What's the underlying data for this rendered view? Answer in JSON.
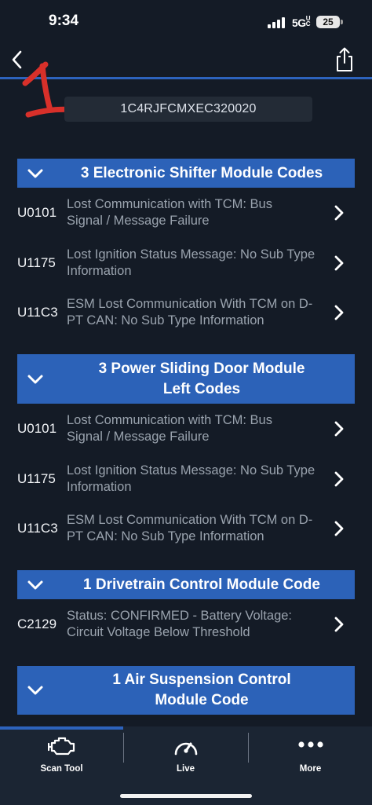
{
  "status_bar": {
    "time": "9:34",
    "network": "5G",
    "network_suffix": "UC",
    "battery": "25"
  },
  "vin": "1C4RJFCMXEC320020",
  "annotation_text": "1",
  "sections": [
    {
      "title_lines": [
        "3 Electronic Shifter Module Codes"
      ],
      "codes": [
        {
          "code": "U0101",
          "lines": [
            "Lost Communication with TCM: Bus",
            "Signal / Message Failure"
          ]
        },
        {
          "code": "U1175",
          "lines": [
            "Lost Ignition Status Message: No Sub Type",
            "Information"
          ]
        },
        {
          "code": "U11C3",
          "lines": [
            "ESM Lost Communication With TCM on D-",
            "PT CAN: No Sub Type Information"
          ]
        }
      ]
    },
    {
      "title_lines": [
        "3 Power Sliding Door Module",
        "Left Codes"
      ],
      "codes": [
        {
          "code": "U0101",
          "lines": [
            "Lost Communication with TCM: Bus",
            "Signal / Message Failure"
          ]
        },
        {
          "code": "U1175",
          "lines": [
            "Lost Ignition Status Message: No Sub Type",
            "Information"
          ]
        },
        {
          "code": "U11C3",
          "lines": [
            "ESM Lost Communication With TCM on D-",
            "PT CAN: No Sub Type Information"
          ]
        }
      ]
    },
    {
      "title_lines": [
        "1 Drivetrain Control Module Code"
      ],
      "codes": [
        {
          "code": "C2129",
          "lines": [
            "Status: CONFIRMED - Battery Voltage:",
            "Circuit Voltage Below Threshold"
          ]
        }
      ]
    },
    {
      "title_lines": [
        "1 Air Suspension Control",
        "Module Code"
      ],
      "codes": []
    }
  ],
  "tabs": [
    {
      "label": "Scan Tool",
      "icon": "engine-icon",
      "selected": true
    },
    {
      "label": "Live",
      "icon": "gauge-icon",
      "selected": false
    },
    {
      "label": "More",
      "icon": "more-dots-icon",
      "selected": false
    }
  ],
  "colors": {
    "background": "#141b26",
    "accent": "#2c62b8",
    "annotation": "#d8302a",
    "tab_bar": "#1b2533"
  }
}
